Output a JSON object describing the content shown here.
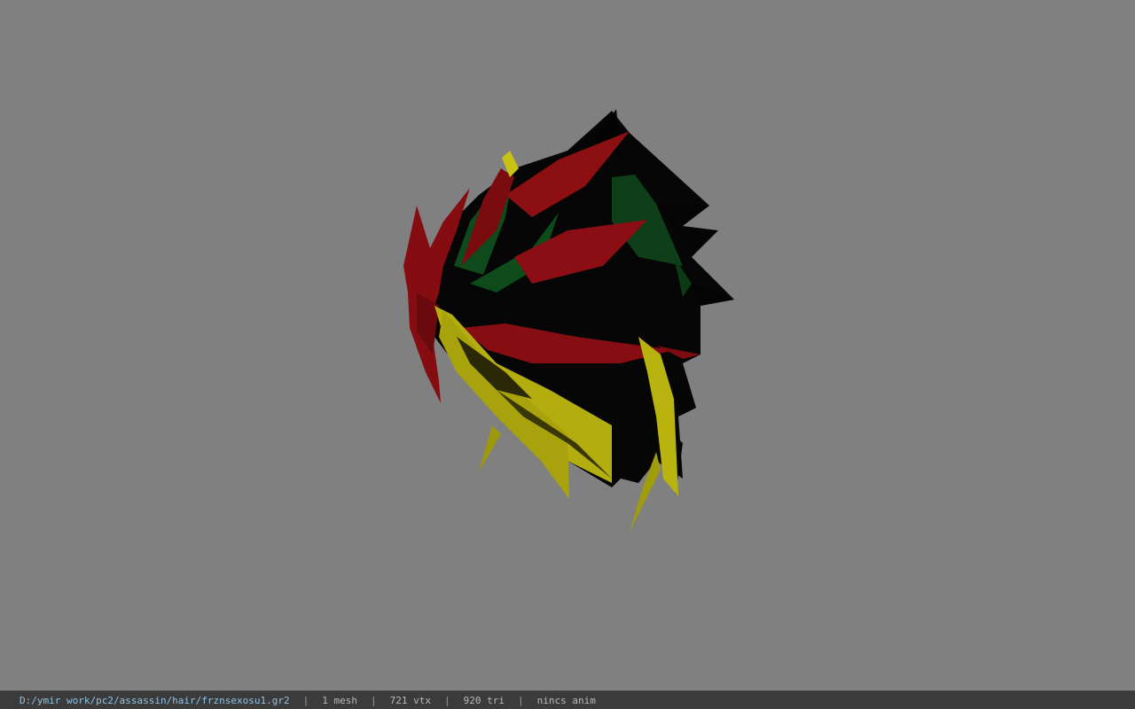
{
  "status_bar": {
    "file_path": "D:/ymir work/pc2/assassin/hair/frznsexosu1.gr2",
    "mesh_count": "1 mesh",
    "vertex_count": "721 vtx",
    "triangle_count": "920 tri",
    "animation_status": "nincs anim",
    "separator": "|"
  },
  "colors": {
    "background": "#808080",
    "status_bar_bg": "#3b3b3b",
    "path_text": "#8ec3e6",
    "info_text": "#b9b9b9",
    "hair_red": "#8a0f12",
    "hair_green": "#0e4a1c",
    "hair_yellow": "#b5b010",
    "hair_shadow": "#050505"
  },
  "viewport": {
    "model_name": "hair-mesh-icon"
  }
}
